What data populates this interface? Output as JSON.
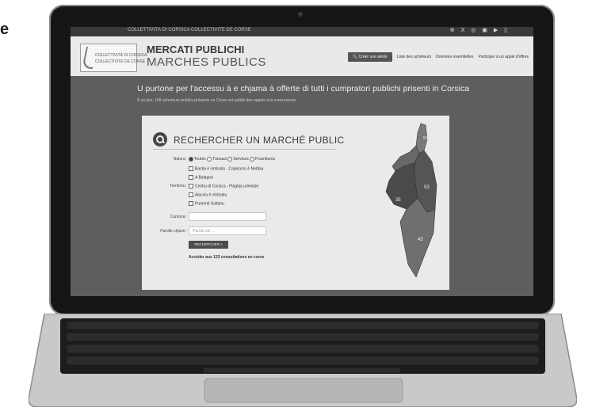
{
  "page_edge_letter": "e",
  "site": {
    "top_strip_text": "COLLETTIVITÀ DI CORSICA COLLECTIVITÉ DE CORSE",
    "socials": "⊕ X ◎ ▣ ▶ ▯",
    "logo_line1": "COLLETTIVITÀ DI CORSICA",
    "logo_line2": "COLLECTIVITÉ DE CORSE",
    "title_line1": "MERCATI PUBLICHI",
    "title_line2": "MARCHES PUBLICS"
  },
  "nav": {
    "alert_button": "Créer une alerte",
    "items": [
      "Liste des acheteurs",
      "Données essentielles",
      "Participer à un appel d'offres"
    ]
  },
  "hero": {
    "text": "U purtone per l'accessu à e chjama à offerte di tutti i cumpratori publichi prisenti in Corsica",
    "subtext": "À ce jour, 158 acheteurs publics présents en Corse ont publié des appels à la concurrence"
  },
  "search": {
    "title": "RECHERCHER UN MARCHÉ PUBLIC",
    "nature_label": "Natura:",
    "nature_options": [
      {
        "label": "Toutes",
        "checked": true
      },
      {
        "label": "Travaux",
        "checked": false
      },
      {
        "label": "Services",
        "checked": false
      },
      {
        "label": "Fournitures",
        "checked": false
      }
    ],
    "territory_label": "Territoriu:",
    "territory_options": [
      "Bastia è cintinatu - Capicorsu è Nebbiu",
      "A Balagna",
      "Centru di Corsica - Piaghja urientale",
      "Aiacciu è cintinatu",
      "Pumonti Suttanu"
    ],
    "commune_label": "Cumuna:",
    "keywords_label": "Parolle chjave:",
    "keywords_placeholder": "Parole clé ...",
    "button_label": "RECHERCHER",
    "access_text": "Accéder aux 133 consultations en cours"
  },
  "map": {
    "badges": [
      "59",
      "53",
      "35",
      "45"
    ],
    "fills": [
      "#7a7a7a",
      "#555555",
      "#686868",
      "#4a4a4a",
      "#6f6f6f"
    ]
  }
}
